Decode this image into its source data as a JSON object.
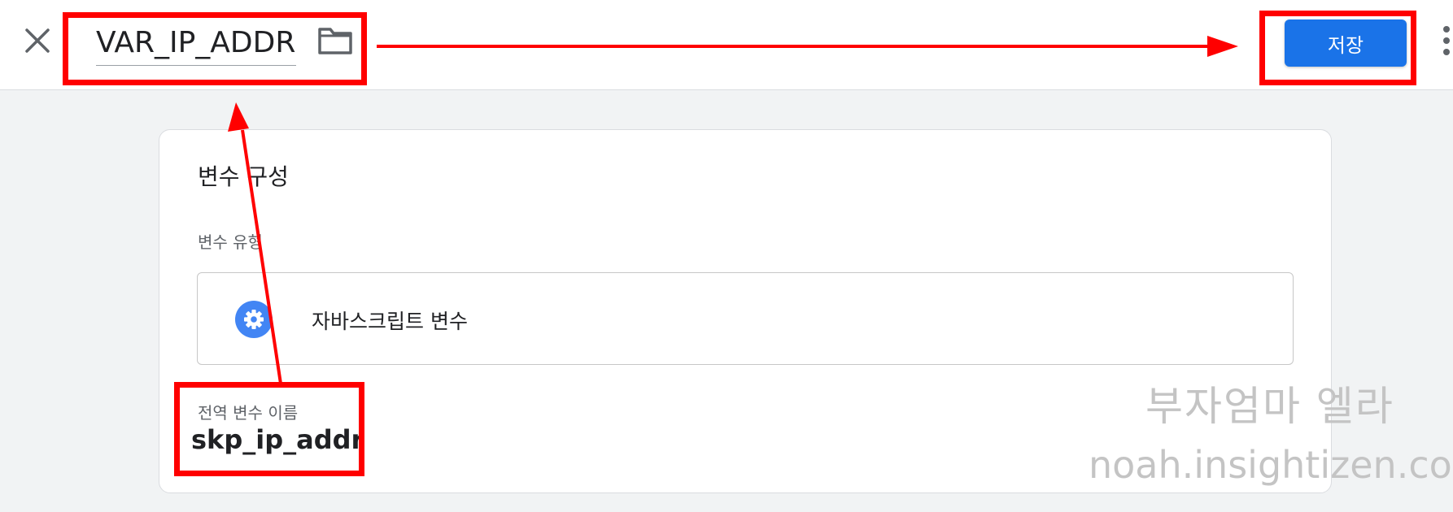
{
  "header": {
    "close_icon": "close-icon",
    "title_value": "VAR_IP_ADDR",
    "folder_icon": "folder-icon",
    "save_label": "저장",
    "more_icon": "more-vert-icon"
  },
  "card": {
    "title": "변수 구성",
    "variable_type_label": "변수 유형",
    "variable_type": {
      "icon": "gear-icon",
      "name": "자바스크립트 변수"
    },
    "global_name_label": "전역 변수 이름",
    "global_name_value": "skp_ip_addr"
  },
  "watermark": {
    "line1": "부자엄마 엘라",
    "line2": "noah.insightizen.com"
  },
  "colors": {
    "accent": "#1a73e8",
    "annotation": "#ff0000",
    "background": "#f1f3f4",
    "watermark": "#c4c4c4"
  }
}
